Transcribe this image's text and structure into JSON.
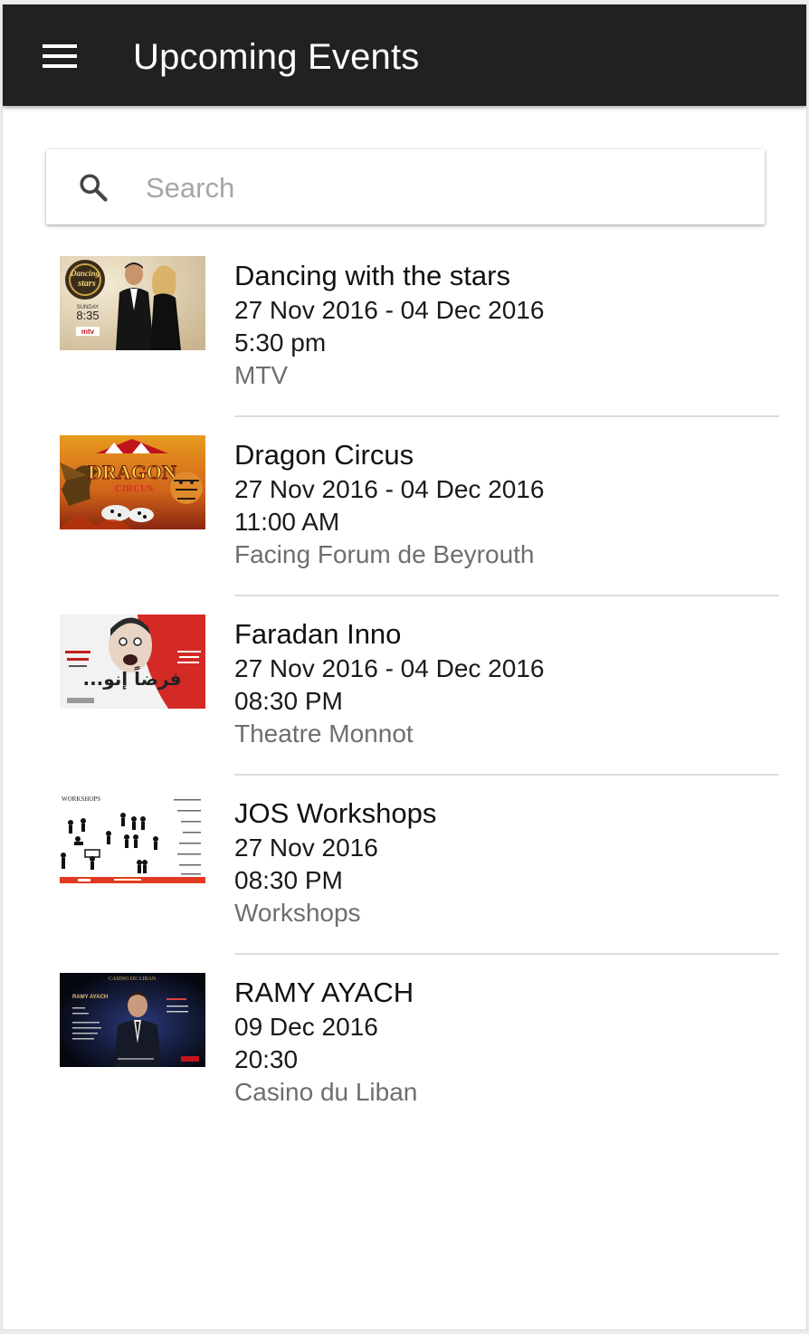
{
  "app_bar": {
    "title": "Upcoming Events",
    "menu_icon": "hamburger-menu-icon",
    "background": "#212121"
  },
  "search": {
    "placeholder": "Search",
    "value": "",
    "icon": "search-icon"
  },
  "events": [
    {
      "title": "Dancing with the stars",
      "dates": "27 Nov 2016 - 04 Dec 2016",
      "time": "5:30 pm",
      "venue": "MTV",
      "thumbnail": "dancing-with-the-stars-poster",
      "thumbnail_text": [
        "Dancing",
        "stars",
        "SUNDAY",
        "8:35",
        "mtv"
      ]
    },
    {
      "title": "Dragon Circus",
      "dates": "27 Nov 2016 - 04 Dec 2016",
      "time": "11:00 AM",
      "venue": "Facing Forum de Beyrouth",
      "thumbnail": "dragon-circus-poster",
      "thumbnail_text": [
        "DRAGON",
        "CIRCUS"
      ]
    },
    {
      "title": "Faradan Inno",
      "dates": "27 Nov 2016 - 04 Dec 2016",
      "time": "08:30 PM",
      "venue": "Theatre Monnot",
      "thumbnail": "faradan-inno-poster",
      "thumbnail_text": [
        "فرضاً إنو..."
      ]
    },
    {
      "title": "JOS Workshops",
      "dates": "27 Nov 2016",
      "time": "08:30 PM",
      "venue": "Workshops",
      "thumbnail": "jos-workshops-poster",
      "thumbnail_text": [
        "WORKSHOPS"
      ]
    },
    {
      "title": "RAMY AYACH",
      "dates": "09 Dec 2016",
      "time": "20:30",
      "venue": "Casino du Liban",
      "thumbnail": "ramy-ayach-poster",
      "thumbnail_text": [
        "CASINO DU LIBAN",
        "RAMY AYACH"
      ]
    }
  ]
}
